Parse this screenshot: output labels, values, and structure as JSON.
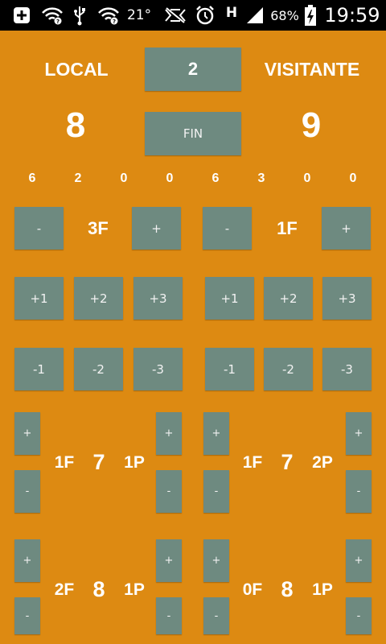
{
  "colors": {
    "background": "#DD8A12",
    "button": "#6E8A80",
    "text": "#FFFFFF"
  },
  "status_bar": {
    "icons": [
      "add-box-icon",
      "wifi-question-icon",
      "usb-icon",
      "wifi-question-icon",
      "mute-icon",
      "alarm-icon",
      "h-signal-icon",
      "cell-signal-icon",
      "battery-charging-icon"
    ],
    "temperature": "21°",
    "network": "H",
    "battery": "68%",
    "time": "19:59"
  },
  "header": {
    "home_label": "LOCAL",
    "period_value": "2",
    "away_label": "VISITANTE",
    "home_score": "8",
    "end_button": "FIN",
    "away_score": "9"
  },
  "stats_home": [
    "6",
    "2",
    "0",
    "0"
  ],
  "stats_away": [
    "6",
    "3",
    "0",
    "0"
  ],
  "fouls": {
    "home_label": "3F",
    "away_label": "1F",
    "minus": "-",
    "plus": "+"
  },
  "points": {
    "add": [
      "+1",
      "+2",
      "+3"
    ],
    "sub": [
      "-1",
      "-2",
      "-3"
    ]
  },
  "players": {
    "plus": "+",
    "minus": "-",
    "rows": [
      {
        "home": {
          "fouls": "1F",
          "number": "7",
          "points": "1P"
        },
        "away": {
          "fouls": "1F",
          "number": "7",
          "points": "2P"
        }
      },
      {
        "home": {
          "fouls": "2F",
          "number": "8",
          "points": "1P"
        },
        "away": {
          "fouls": "0F",
          "number": "8",
          "points": "1P"
        }
      }
    ]
  }
}
